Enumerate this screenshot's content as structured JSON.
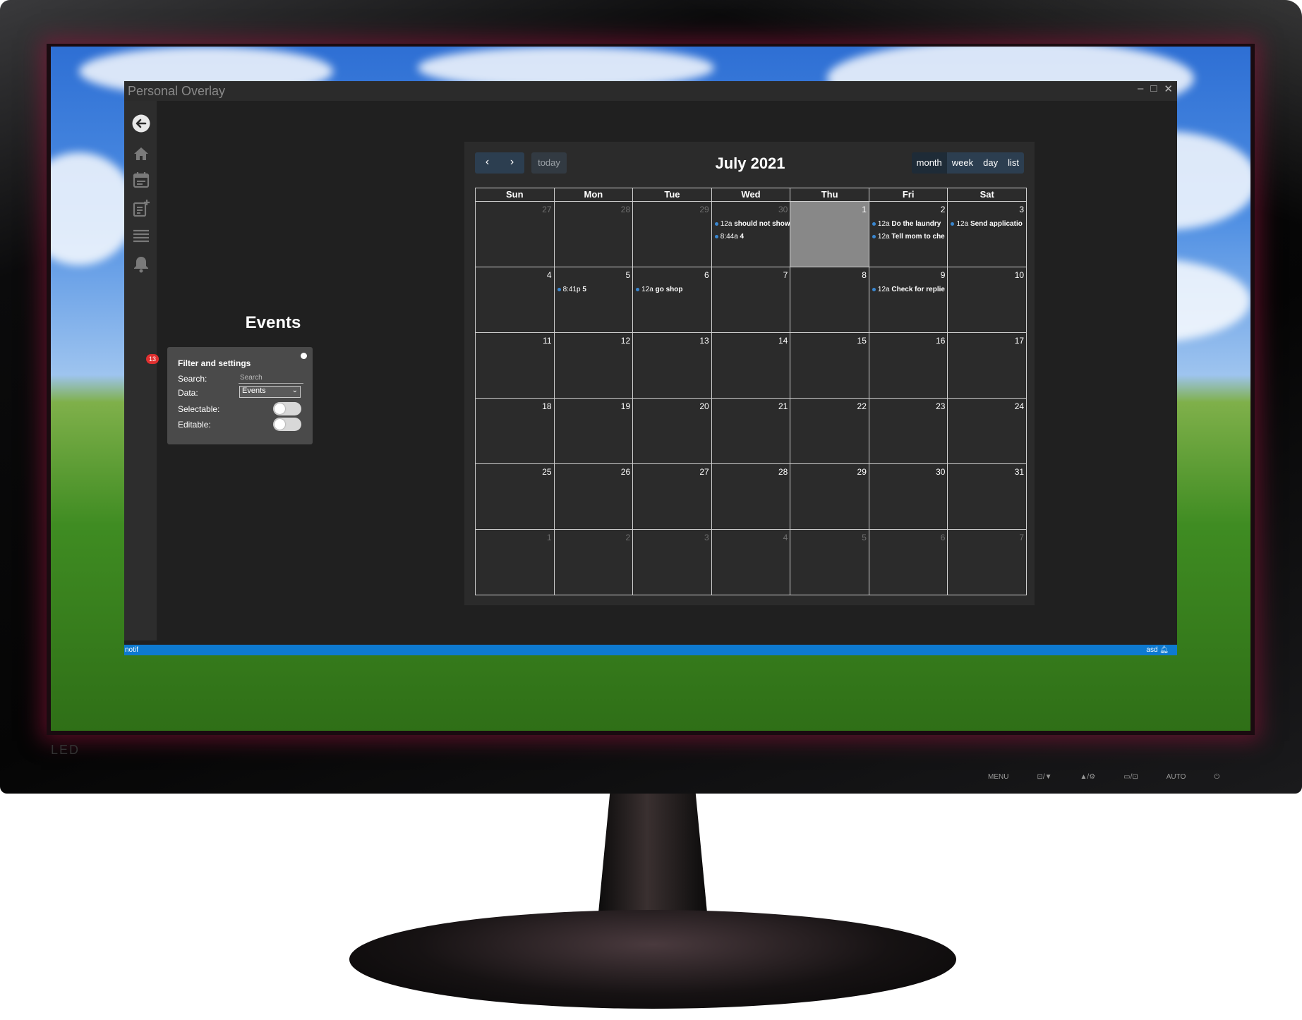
{
  "window": {
    "title": "Personal Overlay"
  },
  "sidebar": {
    "notifications_count": "13"
  },
  "page": {
    "title": "Events"
  },
  "filter": {
    "heading": "Filter and settings",
    "search_label": "Search:",
    "search_placeholder": "Search",
    "data_label": "Data:",
    "data_value": "Events",
    "selectable_label": "Selectable:",
    "editable_label": "Editable:",
    "selectable_on": false,
    "editable_on": false
  },
  "calendar": {
    "title": "July 2021",
    "today_label": "today",
    "views": [
      "month",
      "week",
      "day",
      "list"
    ],
    "active_view": "month",
    "weekdays": [
      "Sun",
      "Mon",
      "Tue",
      "Wed",
      "Thu",
      "Fri",
      "Sat"
    ],
    "today_date": "1",
    "weeks": [
      [
        {
          "day": "27",
          "other": true,
          "events": []
        },
        {
          "day": "28",
          "other": true,
          "events": []
        },
        {
          "day": "29",
          "other": true,
          "events": []
        },
        {
          "day": "30",
          "other": true,
          "events": [
            {
              "time": "12a",
              "title": "should not show"
            },
            {
              "time": "8:44a",
              "title": "4"
            }
          ]
        },
        {
          "day": "1",
          "other": false,
          "today": true,
          "events": []
        },
        {
          "day": "2",
          "other": false,
          "events": [
            {
              "time": "12a",
              "title": "Do the laundry"
            },
            {
              "time": "12a",
              "title": "Tell mom to che"
            }
          ]
        },
        {
          "day": "3",
          "other": false,
          "events": [
            {
              "time": "12a",
              "title": "Send applicatio"
            }
          ]
        }
      ],
      [
        {
          "day": "4",
          "other": false,
          "events": []
        },
        {
          "day": "5",
          "other": false,
          "events": [
            {
              "time": "8:41p",
              "title": "5"
            }
          ]
        },
        {
          "day": "6",
          "other": false,
          "events": [
            {
              "time": "12a",
              "title": "go shop"
            }
          ]
        },
        {
          "day": "7",
          "other": false,
          "events": []
        },
        {
          "day": "8",
          "other": false,
          "events": []
        },
        {
          "day": "9",
          "other": false,
          "events": [
            {
              "time": "12a",
              "title": "Check for replie"
            }
          ]
        },
        {
          "day": "10",
          "other": false,
          "events": []
        }
      ],
      [
        {
          "day": "11",
          "other": false,
          "events": []
        },
        {
          "day": "12",
          "other": false,
          "events": []
        },
        {
          "day": "13",
          "other": false,
          "events": []
        },
        {
          "day": "14",
          "other": false,
          "events": []
        },
        {
          "day": "15",
          "other": false,
          "events": []
        },
        {
          "day": "16",
          "other": false,
          "events": []
        },
        {
          "day": "17",
          "other": false,
          "events": []
        }
      ],
      [
        {
          "day": "18",
          "other": false,
          "events": []
        },
        {
          "day": "19",
          "other": false,
          "events": []
        },
        {
          "day": "20",
          "other": false,
          "events": []
        },
        {
          "day": "21",
          "other": false,
          "events": []
        },
        {
          "day": "22",
          "other": false,
          "events": []
        },
        {
          "day": "23",
          "other": false,
          "events": []
        },
        {
          "day": "24",
          "other": false,
          "events": []
        }
      ],
      [
        {
          "day": "25",
          "other": false,
          "events": []
        },
        {
          "day": "26",
          "other": false,
          "events": []
        },
        {
          "day": "27",
          "other": false,
          "events": []
        },
        {
          "day": "28",
          "other": false,
          "events": []
        },
        {
          "day": "29",
          "other": false,
          "events": []
        },
        {
          "day": "30",
          "other": false,
          "events": []
        },
        {
          "day": "31",
          "other": false,
          "events": []
        }
      ],
      [
        {
          "day": "1",
          "other": true,
          "events": []
        },
        {
          "day": "2",
          "other": true,
          "events": []
        },
        {
          "day": "3",
          "other": true,
          "events": []
        },
        {
          "day": "4",
          "other": true,
          "events": []
        },
        {
          "day": "5",
          "other": true,
          "events": []
        },
        {
          "day": "6",
          "other": true,
          "events": []
        },
        {
          "day": "7",
          "other": true,
          "events": []
        }
      ]
    ]
  },
  "statusbar": {
    "left": "notif",
    "right": "asd"
  },
  "monitor": {
    "brand": "LED",
    "buttons": [
      "MENU",
      "⊡/▼",
      "▲/⚙",
      "▭/⊡",
      "AUTO",
      "⏻"
    ]
  },
  "colors": {
    "accent": "#0e7ad0",
    "event_dot": "#3a87d0",
    "badge": "#e03030",
    "calendar_button": "#2c3e50"
  }
}
